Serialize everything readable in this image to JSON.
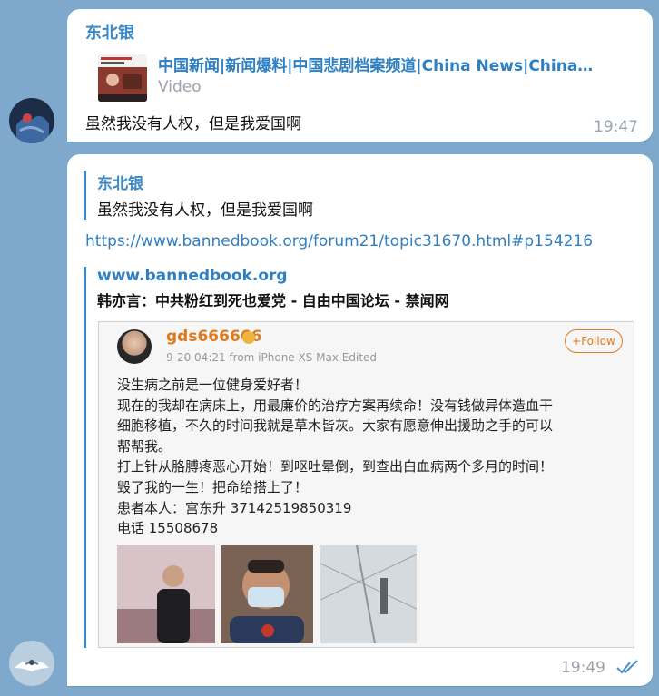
{
  "messages": [
    {
      "sender": "东北银",
      "link_preview": {
        "title": "中国新闻|新闻爆料|中国悲剧档案频道|China News|China…",
        "subtitle": "Video"
      },
      "text": "虽然我没有人权，但是我爱国啊",
      "time": "19:47"
    },
    {
      "quote": {
        "sender": "东北银",
        "text": "虽然我没有人权，但是我爱国啊"
      },
      "url": "https://www.bannedbook.org/forum21/topic31670.html#p154216",
      "link_preview": {
        "site": "www.bannedbook.org",
        "title": "韩亦言：中共粉红到死也爱党 - 自由中国论坛 - 禁闻网"
      },
      "screenshot": {
        "username": "gds666666",
        "meta": "9-20 04:21  from iPhone XS Max  Edited",
        "follow_label": "+Follow",
        "lines": [
          "没生病之前是一位健身爱好者！",
          "现在的我却在病床上，用最廉价的治疗方案再续命！没有钱做异体造血干",
          "细胞移植，不久的时间我就是草木皆灰。大家有愿意伸出援助之手的可以",
          "帮帮我。",
          "打上针从胳膊疼恶心开始！到呕吐晕倒，到查出白血病两个多月的时间！",
          "毁了我的一生！把命给搭上了！",
          "患者本人：宫东升 37142519850319",
          "电话 15508678"
        ]
      },
      "time": "19:49",
      "status": "read"
    }
  ],
  "colors": {
    "background": "#7fa9cc",
    "accent": "#3a8ac9",
    "link": "#2f7fc1",
    "time": "#9aa4ad"
  },
  "icons": {
    "read_status": "double-check-icon"
  }
}
